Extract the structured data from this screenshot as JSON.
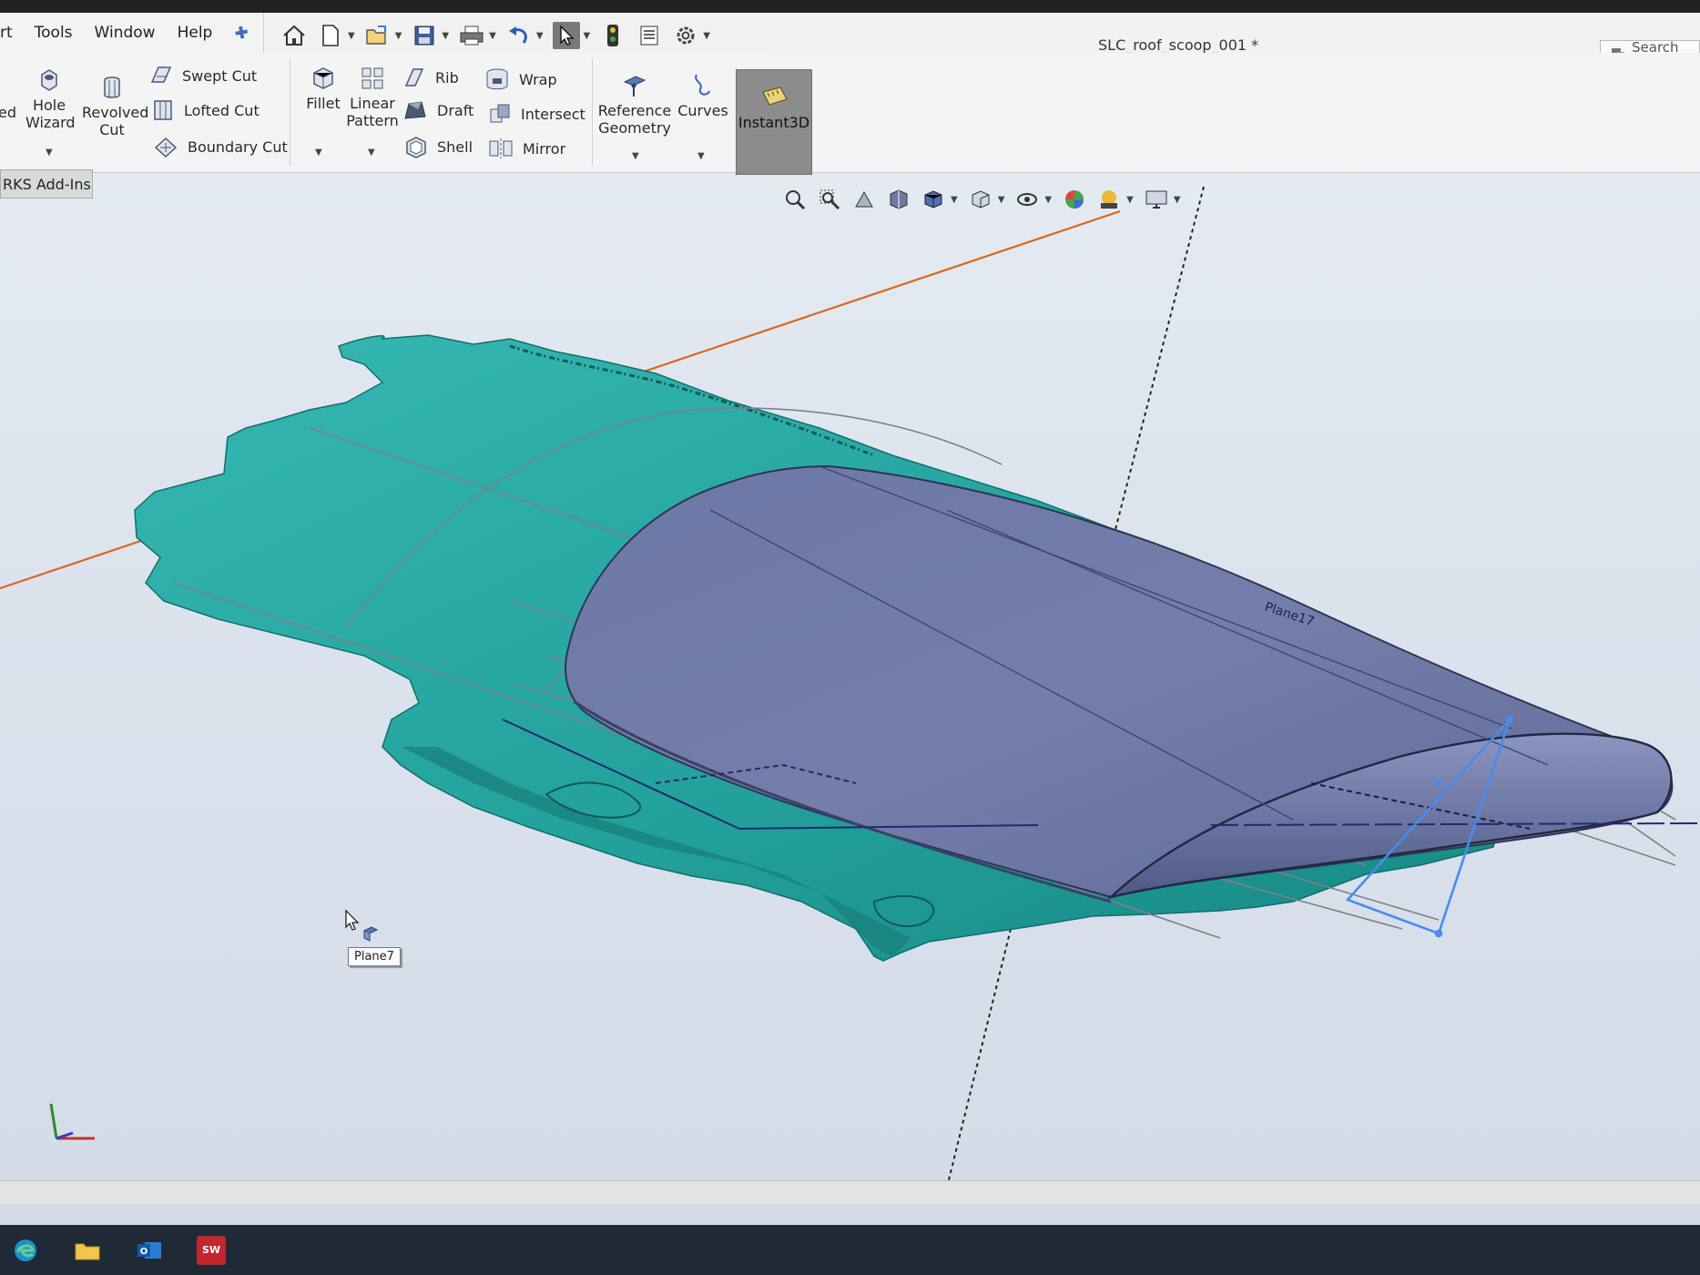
{
  "menu": {
    "items": [
      "rt",
      "Tools",
      "Window",
      "Help"
    ]
  },
  "document": {
    "title": "SLC_roof_scoop_001 *"
  },
  "search": {
    "label": "Search Co"
  },
  "ribbon": {
    "partial_left_label": "ed",
    "hole_wizard": [
      "Hole",
      "Wizard"
    ],
    "revolved_cut": [
      "Revolved",
      "Cut"
    ],
    "swept_cut": "Swept Cut",
    "lofted_cut": "Lofted Cut",
    "boundary_cut": "Boundary Cut",
    "fillet": "Fillet",
    "linear_pattern": [
      "Linear",
      "Pattern"
    ],
    "rib": "Rib",
    "draft": "Draft",
    "shell": "Shell",
    "wrap": "Wrap",
    "intersect": "Intersect",
    "mirror": "Mirror",
    "reference_geometry": [
      "Reference",
      "Geometry"
    ],
    "curves": "Curves",
    "instant3d": "Instant3D"
  },
  "tabs": {
    "addins": "RKS Add-Ins"
  },
  "viewport": {
    "plane_label": "Plane7",
    "plane_overlay_text": "Plane17"
  },
  "taskbar": {
    "items": [
      "edge-icon",
      "folder-icon",
      "outlook-icon",
      "solidworks-icon"
    ],
    "sw_badge": "SW"
  },
  "colors": {
    "scan_teal": "#2aa6a1",
    "surface_slate": "#6f7ba6",
    "axis_orange": "#d9691f",
    "sketch_blue": "#4a8bea"
  }
}
